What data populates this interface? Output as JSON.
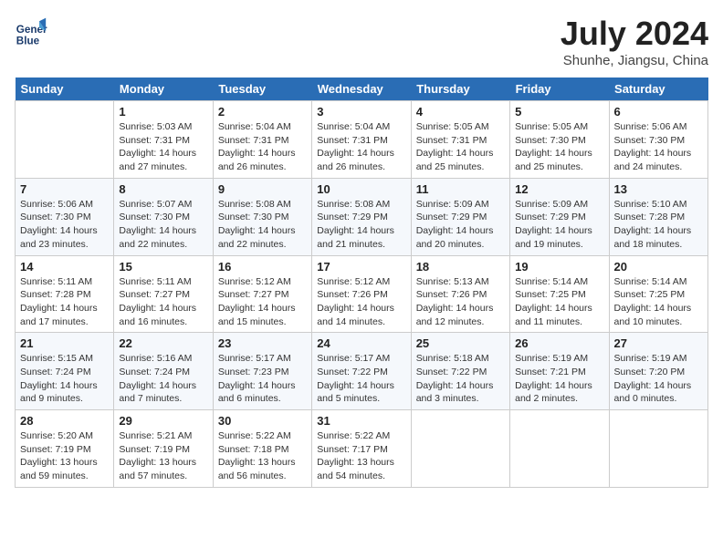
{
  "header": {
    "logo_line1": "General",
    "logo_line2": "Blue",
    "month": "July 2024",
    "location": "Shunhe, Jiangsu, China"
  },
  "weekdays": [
    "Sunday",
    "Monday",
    "Tuesday",
    "Wednesday",
    "Thursday",
    "Friday",
    "Saturday"
  ],
  "weeks": [
    [
      {
        "day": "",
        "sunrise": "",
        "sunset": "",
        "daylight": ""
      },
      {
        "day": "1",
        "sunrise": "Sunrise: 5:03 AM",
        "sunset": "Sunset: 7:31 PM",
        "daylight": "Daylight: 14 hours and 27 minutes."
      },
      {
        "day": "2",
        "sunrise": "Sunrise: 5:04 AM",
        "sunset": "Sunset: 7:31 PM",
        "daylight": "Daylight: 14 hours and 26 minutes."
      },
      {
        "day": "3",
        "sunrise": "Sunrise: 5:04 AM",
        "sunset": "Sunset: 7:31 PM",
        "daylight": "Daylight: 14 hours and 26 minutes."
      },
      {
        "day": "4",
        "sunrise": "Sunrise: 5:05 AM",
        "sunset": "Sunset: 7:31 PM",
        "daylight": "Daylight: 14 hours and 25 minutes."
      },
      {
        "day": "5",
        "sunrise": "Sunrise: 5:05 AM",
        "sunset": "Sunset: 7:30 PM",
        "daylight": "Daylight: 14 hours and 25 minutes."
      },
      {
        "day": "6",
        "sunrise": "Sunrise: 5:06 AM",
        "sunset": "Sunset: 7:30 PM",
        "daylight": "Daylight: 14 hours and 24 minutes."
      }
    ],
    [
      {
        "day": "7",
        "sunrise": "Sunrise: 5:06 AM",
        "sunset": "Sunset: 7:30 PM",
        "daylight": "Daylight: 14 hours and 23 minutes."
      },
      {
        "day": "8",
        "sunrise": "Sunrise: 5:07 AM",
        "sunset": "Sunset: 7:30 PM",
        "daylight": "Daylight: 14 hours and 22 minutes."
      },
      {
        "day": "9",
        "sunrise": "Sunrise: 5:08 AM",
        "sunset": "Sunset: 7:30 PM",
        "daylight": "Daylight: 14 hours and 22 minutes."
      },
      {
        "day": "10",
        "sunrise": "Sunrise: 5:08 AM",
        "sunset": "Sunset: 7:29 PM",
        "daylight": "Daylight: 14 hours and 21 minutes."
      },
      {
        "day": "11",
        "sunrise": "Sunrise: 5:09 AM",
        "sunset": "Sunset: 7:29 PM",
        "daylight": "Daylight: 14 hours and 20 minutes."
      },
      {
        "day": "12",
        "sunrise": "Sunrise: 5:09 AM",
        "sunset": "Sunset: 7:29 PM",
        "daylight": "Daylight: 14 hours and 19 minutes."
      },
      {
        "day": "13",
        "sunrise": "Sunrise: 5:10 AM",
        "sunset": "Sunset: 7:28 PM",
        "daylight": "Daylight: 14 hours and 18 minutes."
      }
    ],
    [
      {
        "day": "14",
        "sunrise": "Sunrise: 5:11 AM",
        "sunset": "Sunset: 7:28 PM",
        "daylight": "Daylight: 14 hours and 17 minutes."
      },
      {
        "day": "15",
        "sunrise": "Sunrise: 5:11 AM",
        "sunset": "Sunset: 7:27 PM",
        "daylight": "Daylight: 14 hours and 16 minutes."
      },
      {
        "day": "16",
        "sunrise": "Sunrise: 5:12 AM",
        "sunset": "Sunset: 7:27 PM",
        "daylight": "Daylight: 14 hours and 15 minutes."
      },
      {
        "day": "17",
        "sunrise": "Sunrise: 5:12 AM",
        "sunset": "Sunset: 7:26 PM",
        "daylight": "Daylight: 14 hours and 14 minutes."
      },
      {
        "day": "18",
        "sunrise": "Sunrise: 5:13 AM",
        "sunset": "Sunset: 7:26 PM",
        "daylight": "Daylight: 14 hours and 12 minutes."
      },
      {
        "day": "19",
        "sunrise": "Sunrise: 5:14 AM",
        "sunset": "Sunset: 7:25 PM",
        "daylight": "Daylight: 14 hours and 11 minutes."
      },
      {
        "day": "20",
        "sunrise": "Sunrise: 5:14 AM",
        "sunset": "Sunset: 7:25 PM",
        "daylight": "Daylight: 14 hours and 10 minutes."
      }
    ],
    [
      {
        "day": "21",
        "sunrise": "Sunrise: 5:15 AM",
        "sunset": "Sunset: 7:24 PM",
        "daylight": "Daylight: 14 hours and 9 minutes."
      },
      {
        "day": "22",
        "sunrise": "Sunrise: 5:16 AM",
        "sunset": "Sunset: 7:24 PM",
        "daylight": "Daylight: 14 hours and 7 minutes."
      },
      {
        "day": "23",
        "sunrise": "Sunrise: 5:17 AM",
        "sunset": "Sunset: 7:23 PM",
        "daylight": "Daylight: 14 hours and 6 minutes."
      },
      {
        "day": "24",
        "sunrise": "Sunrise: 5:17 AM",
        "sunset": "Sunset: 7:22 PM",
        "daylight": "Daylight: 14 hours and 5 minutes."
      },
      {
        "day": "25",
        "sunrise": "Sunrise: 5:18 AM",
        "sunset": "Sunset: 7:22 PM",
        "daylight": "Daylight: 14 hours and 3 minutes."
      },
      {
        "day": "26",
        "sunrise": "Sunrise: 5:19 AM",
        "sunset": "Sunset: 7:21 PM",
        "daylight": "Daylight: 14 hours and 2 minutes."
      },
      {
        "day": "27",
        "sunrise": "Sunrise: 5:19 AM",
        "sunset": "Sunset: 7:20 PM",
        "daylight": "Daylight: 14 hours and 0 minutes."
      }
    ],
    [
      {
        "day": "28",
        "sunrise": "Sunrise: 5:20 AM",
        "sunset": "Sunset: 7:19 PM",
        "daylight": "Daylight: 13 hours and 59 minutes."
      },
      {
        "day": "29",
        "sunrise": "Sunrise: 5:21 AM",
        "sunset": "Sunset: 7:19 PM",
        "daylight": "Daylight: 13 hours and 57 minutes."
      },
      {
        "day": "30",
        "sunrise": "Sunrise: 5:22 AM",
        "sunset": "Sunset: 7:18 PM",
        "daylight": "Daylight: 13 hours and 56 minutes."
      },
      {
        "day": "31",
        "sunrise": "Sunrise: 5:22 AM",
        "sunset": "Sunset: 7:17 PM",
        "daylight": "Daylight: 13 hours and 54 minutes."
      },
      {
        "day": "",
        "sunrise": "",
        "sunset": "",
        "daylight": ""
      },
      {
        "day": "",
        "sunrise": "",
        "sunset": "",
        "daylight": ""
      },
      {
        "day": "",
        "sunrise": "",
        "sunset": "",
        "daylight": ""
      }
    ]
  ]
}
